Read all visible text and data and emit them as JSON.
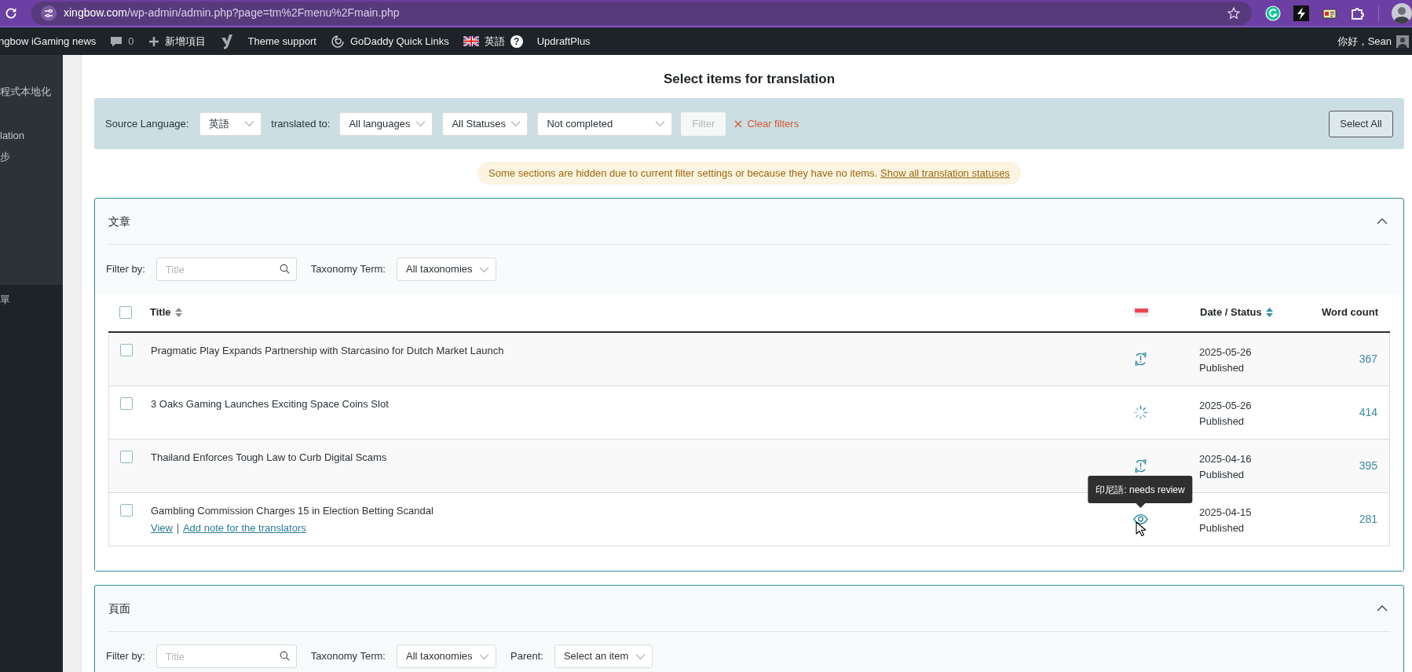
{
  "browser": {
    "url_domain": "xingbow.com",
    "url_path": "/wp-admin/admin.php?page=tm%2Fmenu%2Fmain.php"
  },
  "admin_bar": {
    "items": [
      {
        "kind": "site",
        "label": "ngbow iGaming news"
      },
      {
        "kind": "comments",
        "label": "0"
      },
      {
        "kind": "new",
        "label": "新增項目"
      },
      {
        "kind": "seo"
      },
      {
        "kind": "link",
        "label": "Theme support"
      },
      {
        "kind": "quick_links",
        "label": "GoDaddy Quick Links"
      },
      {
        "kind": "language",
        "label": "英語",
        "badge": "?"
      },
      {
        "kind": "link",
        "label": "UpdraftPlus"
      }
    ],
    "greeting": "你好，Sean"
  },
  "sidebar": {
    "items": [
      {
        "label": "程式本地化"
      },
      {
        "label": "lation"
      },
      {
        "label": "步"
      },
      {
        "label": "單"
      }
    ]
  },
  "page": {
    "title": "Select items for translation",
    "filters": {
      "source_label": "Source Language:",
      "source": "英語",
      "target_label": "translated to:",
      "target": "All languages",
      "status": "All Statuses",
      "completion": "Not completed",
      "filter_button": {
        "label": "Filter",
        "disabled": true
      },
      "clear": "Clear filters",
      "select_all": "Select All"
    },
    "notice": {
      "text": "Some sections are hidden due to current filter settings or because they have no items.",
      "link": "Show all translation statuses"
    },
    "sections": [
      {
        "title": "文章",
        "expanded": true,
        "filters": [
          {
            "kind": "search",
            "label": "Filter by:",
            "placeholder": "Title"
          },
          {
            "kind": "select",
            "label": "Taxonomy Term:",
            "value": "All taxonomies"
          }
        ],
        "table": {
          "columns": {
            "title": "Title",
            "date": "Date / Status",
            "words": "Word count"
          },
          "all_checked": false,
          "rows": [
            {
              "checked": false,
              "title": "Pragmatic Play Expands Partnership with Starcasino for Dutch Market Launch",
              "kind": "needs_update",
              "date": "2025-05-26",
              "state": "Published",
              "words": "367"
            },
            {
              "checked": false,
              "title": "3 Oaks Gaming Launches Exciting Space Coins Slot",
              "kind": "in_progress",
              "date": "2025-05-26",
              "state": "Published",
              "words": "414"
            },
            {
              "checked": false,
              "title": "Thailand Enforces Tough Law to Curb Digital Scams",
              "kind": "needs_update",
              "date": "2025-04-16",
              "state": "Published",
              "words": "395"
            },
            {
              "checked": false,
              "title": "Gambling Commission Charges 15 in Election Betting Scandal",
              "kind": "needs_review",
              "date": "2025-04-15",
              "state": "Published",
              "words": "281",
              "actions": [
                "View",
                "Add note for the translators"
              ],
              "tooltip": "印尼語: needs review"
            }
          ]
        }
      },
      {
        "title": "頁面",
        "expanded": true,
        "filters": [
          {
            "kind": "search",
            "label": "Filter by:",
            "placeholder": "Title"
          },
          {
            "kind": "select",
            "label": "Taxonomy Term:",
            "value": "All taxonomies"
          },
          {
            "kind": "select",
            "label": "Parent:",
            "value": "Select an item"
          }
        ]
      }
    ]
  }
}
